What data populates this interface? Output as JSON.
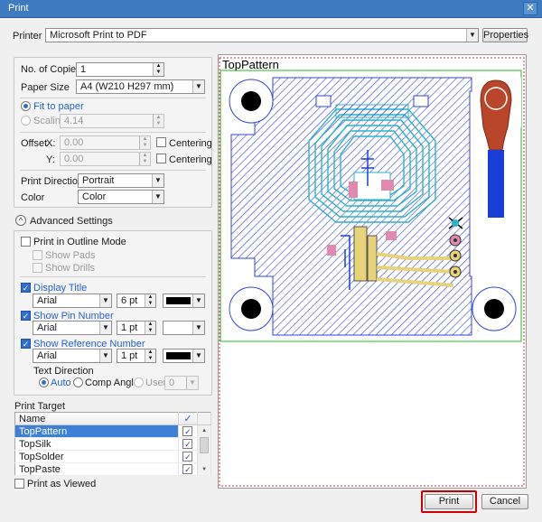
{
  "window": {
    "title": "Print",
    "close_glyph": "✕"
  },
  "printer": {
    "label": "Printer",
    "value": "Microsoft Print to PDF",
    "properties_label": "Properties"
  },
  "copies": {
    "label": "No. of Copies",
    "value": "1"
  },
  "paper_size": {
    "label": "Paper Size",
    "value": "A4 (W210 H297 mm)"
  },
  "fit_to_paper": {
    "label": "Fit to paper",
    "selected": true
  },
  "scaling": {
    "label": "Scaling",
    "value": "4.14"
  },
  "offset": {
    "label": "Offset",
    "x_label": "X:",
    "x_value": "0.00",
    "y_label": "Y:",
    "y_value": "0.00",
    "centering_label": "Centering"
  },
  "print_direction": {
    "label": "Print Direction",
    "value": "Portrait"
  },
  "color": {
    "label": "Color",
    "value": "Color"
  },
  "advanced": {
    "label": "Advanced Settings",
    "outline_mode": "Print in Outline Mode",
    "show_pads": "Show Pads",
    "show_drills": "Show Drills",
    "display_title": {
      "label": "Display Title",
      "font": "Arial",
      "size": "6 pt",
      "color": "#000000"
    },
    "show_pin_number": {
      "label": "Show Pin Number",
      "font": "Arial",
      "size": "1 pt",
      "color": "#ffffff"
    },
    "show_reference_number": {
      "label": "Show Reference Number",
      "font": "Arial",
      "size": "1 pt",
      "color": "#000000"
    },
    "text_direction": {
      "label": "Text Direction",
      "auto": "Auto",
      "comp_angle": "Comp Angle",
      "user": "User",
      "user_value": "0"
    }
  },
  "print_target": {
    "label": "Print Target",
    "column_name": "Name",
    "rows": [
      {
        "name": "TopPattern",
        "checked": true
      },
      {
        "name": "TopSilk",
        "checked": true
      },
      {
        "name": "TopSolder",
        "checked": true
      },
      {
        "name": "TopPaste",
        "checked": true
      }
    ]
  },
  "print_as_viewed": "Print as Viewed",
  "preview": {
    "title": "TopPattern"
  },
  "buttons": {
    "print": "Print",
    "cancel": "Cancel"
  },
  "colors": {
    "accent": "#3d7abf",
    "highlight": "#cc0000",
    "selection": "#3d80d8",
    "pattern_blue": "#3344dd",
    "pattern_cyan": "#2ab3c8",
    "pad_red": "#b9452a"
  },
  "icons": {
    "check": "✓",
    "chevron": "▼",
    "collapse": "^",
    "spin_up": "▲",
    "spin_down": "▼"
  }
}
